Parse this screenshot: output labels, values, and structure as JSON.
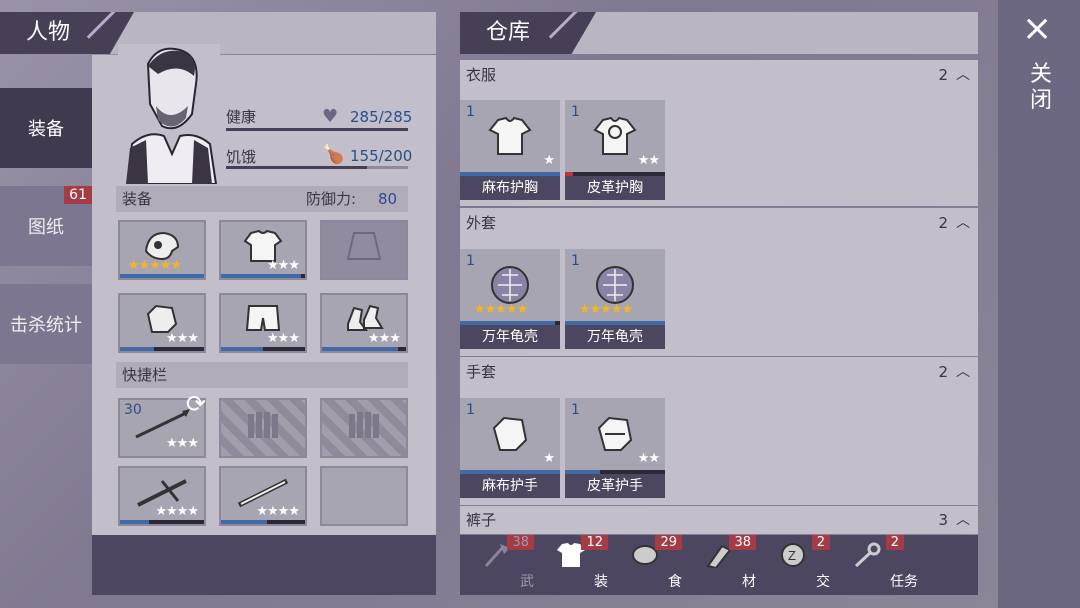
{
  "character": {
    "title": "人物",
    "tabs": [
      {
        "label": "装备"
      },
      {
        "label": "图纸",
        "badge": "61"
      },
      {
        "label": "击杀统计"
      }
    ],
    "health": {
      "label": "健康",
      "value": "285/285",
      "fraction": 1.0
    },
    "hunger": {
      "label": "饥饿",
      "value": "155/200",
      "fraction": 0.775
    },
    "equipment": {
      "label": "装备",
      "defense_label": "防御力:",
      "defense_value": "80"
    },
    "quickbar": {
      "label": "快捷栏",
      "spear_count": "30"
    }
  },
  "storage": {
    "title": "仓库",
    "categories": [
      {
        "name": "衣服",
        "count": "2",
        "items": [
          {
            "count": "1",
            "name": "麻布护胸",
            "stars": "★"
          },
          {
            "count": "1",
            "name": "皮革护胸",
            "stars": "★★"
          }
        ]
      },
      {
        "name": "外套",
        "count": "2",
        "items": [
          {
            "count": "1",
            "name": "万年龟壳",
            "stars": "★★★★★"
          },
          {
            "count": "1",
            "name": "万年龟壳",
            "stars": "★★★★★"
          }
        ]
      },
      {
        "name": "手套",
        "count": "2",
        "items": [
          {
            "count": "1",
            "name": "麻布护手",
            "stars": "★"
          },
          {
            "count": "1",
            "name": "皮革护手",
            "stars": "★★"
          }
        ]
      },
      {
        "name": "裤子",
        "count": "3"
      }
    ]
  },
  "bottom_tabs": [
    {
      "label": "武器",
      "badge": "38"
    },
    {
      "label": "装备",
      "badge": "12"
    },
    {
      "label": "食物",
      "badge": "29"
    },
    {
      "label": "材料",
      "badge": "38"
    },
    {
      "label": "交易",
      "badge": "2"
    },
    {
      "label": "任务",
      "badge": "2"
    }
  ],
  "close": {
    "label": "关闭",
    "icon": "×"
  },
  "equip_slot_stars": [
    "★★★★★",
    "★★★",
    "",
    "★★★",
    "★★★",
    "★★★"
  ],
  "quick_slot_stars": [
    "★★★",
    "",
    "",
    "★★★★",
    "★★★★",
    ""
  ],
  "colors": {
    "accent": "#463f56",
    "badge": "#a43b45",
    "bar": "#3f6aa5",
    "gold": "#f2b526"
  }
}
